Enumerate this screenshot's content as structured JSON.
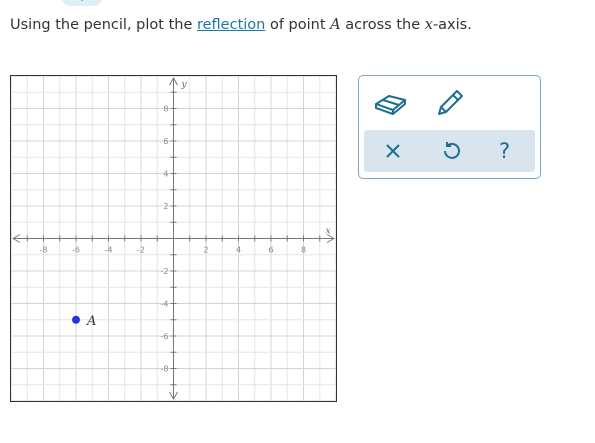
{
  "question": {
    "prefix": "Using the pencil, plot the ",
    "link_text": "reflection",
    "middle": " of point ",
    "point_var": "A",
    "suffix_a": " across the ",
    "axis_var": "x",
    "suffix_b": "-axis."
  },
  "graph": {
    "x_axis_label": "x",
    "y_axis_label": "y",
    "x_range": [
      -10,
      10
    ],
    "y_range": [
      -10,
      10
    ],
    "x_tick_labels": [
      "-8",
      "-6",
      "-4",
      "-2",
      "2",
      "4",
      "6",
      "8"
    ],
    "y_tick_labels": [
      "8",
      "6",
      "4",
      "2",
      "-2",
      "-4",
      "-6",
      "-8"
    ],
    "point": {
      "label": "A",
      "x": -6,
      "y": -5,
      "color": "#2b35d6"
    }
  },
  "tools": {
    "icons": [
      "eraser-icon",
      "pencil-icon"
    ],
    "actions": [
      "close-icon",
      "undo-icon",
      "help-icon"
    ],
    "help_symbol": "?",
    "accent_color": "#1d6e8f"
  }
}
